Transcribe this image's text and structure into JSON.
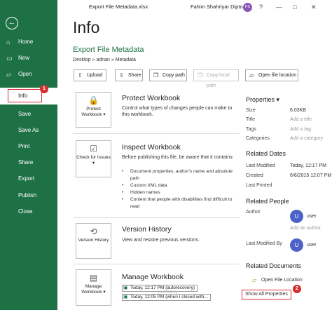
{
  "window": {
    "title": "Export File Metadata.xlsx",
    "user_name": "Fahim Shahriyar Dipto",
    "user_initials": "FS",
    "controls": [
      "?",
      "—",
      "□",
      "✕"
    ]
  },
  "sidebar": {
    "items": [
      {
        "label": "Home",
        "icon": "home-icon",
        "glyph": "⌂"
      },
      {
        "label": "New",
        "icon": "new-doc-icon",
        "glyph": "▭"
      },
      {
        "label": "Open",
        "icon": "folder-icon",
        "glyph": "▱"
      },
      {
        "label": "Info"
      },
      {
        "label": "Save"
      },
      {
        "label": "Save As"
      },
      {
        "label": "Print"
      },
      {
        "label": "Share"
      },
      {
        "label": "Export"
      },
      {
        "label": "Publish"
      },
      {
        "label": "Close"
      }
    ],
    "badge_info": "1"
  },
  "main": {
    "heading": "Info",
    "file_title": "Export File Metadata",
    "breadcrumb": "Desktop » adnan » Metadata",
    "buttons": {
      "upload": "Upload",
      "share": "Share",
      "copy_path": "Copy path",
      "copy_local_path": "Copy local path",
      "open_location": "Open file location"
    },
    "protect": {
      "card_label": "Protect Workbook",
      "title": "Protect Workbook",
      "desc": "Control what types of changes people can make to this workbook."
    },
    "inspect": {
      "card_label": "Check for Issues",
      "title": "Inspect Workbook",
      "desc": "Before publishing this file, be aware that it contains:",
      "bullets": [
        "Document properties, author's name and absolute path",
        "Custom XML data",
        "Hidden names",
        "Content that people with disabilities find difficult to read"
      ]
    },
    "version": {
      "card_label": "Version History",
      "title": "Version History",
      "desc": "View and restore previous versions."
    },
    "manage": {
      "card_label": "Manage Workbook",
      "title": "Manage Workbook",
      "autosaves": [
        "Today, 12:17 PM (autorecovery)",
        "Today, 12:05 PM (when I closed with..."
      ]
    }
  },
  "properties": {
    "heading": "Properties",
    "rows": [
      {
        "label": "Size",
        "value": "6.03KB",
        "placeholder": false
      },
      {
        "label": "Title",
        "value": "Add a title",
        "placeholder": true
      },
      {
        "label": "Tags",
        "value": "Add a tag",
        "placeholder": true
      },
      {
        "label": "Categories",
        "value": "Add a category",
        "placeholder": true
      }
    ],
    "dates_heading": "Related Dates",
    "dates": [
      {
        "label": "Last Modified",
        "value": "Today, 12:17 PM"
      },
      {
        "label": "Created",
        "value": "6/6/2015 12:07 PM"
      },
      {
        "label": "Last Printed",
        "value": ""
      }
    ],
    "people_heading": "Related People",
    "author_label": "Author",
    "author_initial": "U",
    "author_name": "user",
    "add_author": "Add an author",
    "modified_by_label": "Last Modified By",
    "modified_by_initial": "U",
    "modified_by_name": "user",
    "docs_heading": "Related Documents",
    "open_location": "Open File Location",
    "show_all": "Show All Properties",
    "badge_showall": "2"
  },
  "watermark": "exceldemy"
}
